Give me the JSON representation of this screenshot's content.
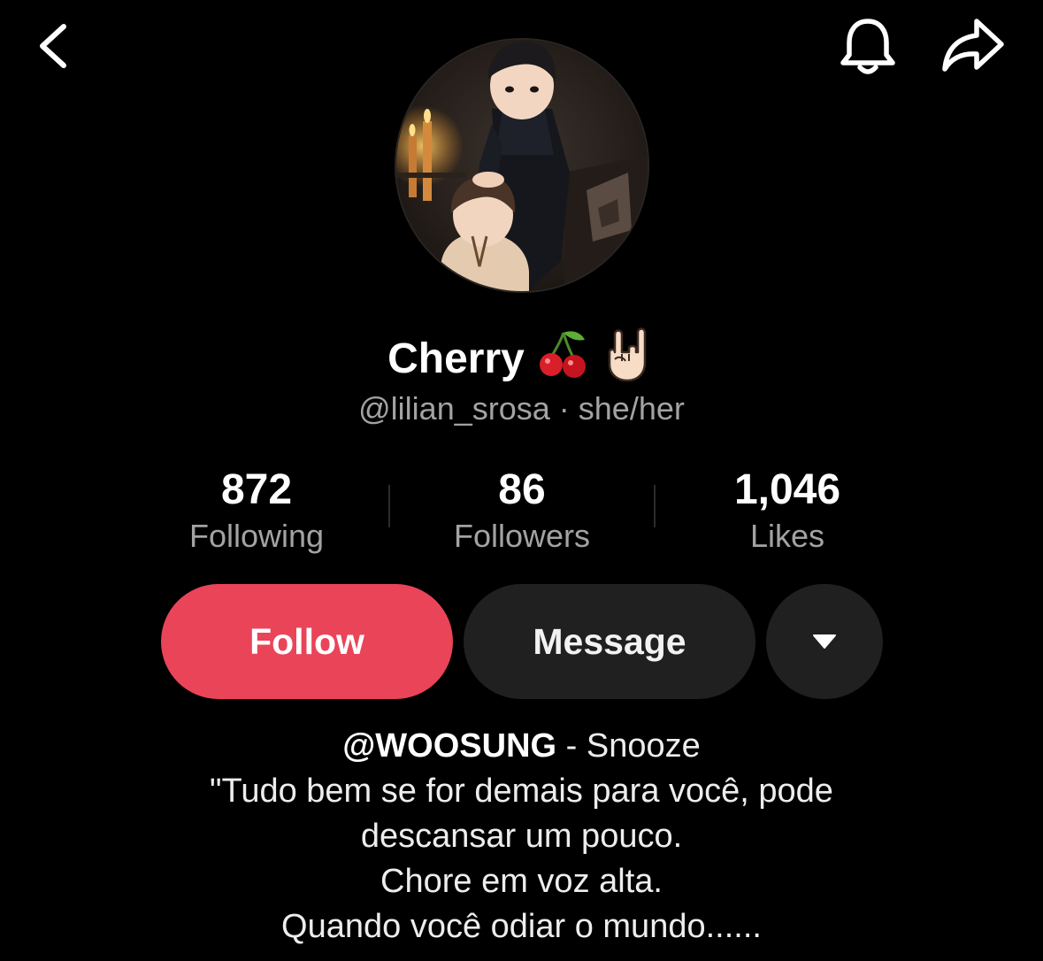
{
  "header": {
    "back_icon": "chevron-left-icon",
    "notification_icon": "bell-icon",
    "share_icon": "share-arrow-icon"
  },
  "profile": {
    "display_name": "Cherry",
    "name_emojis": [
      "🍒",
      "🤘🏻"
    ],
    "username": "@lilian_srosa",
    "separator": "·",
    "pronouns": "she/her"
  },
  "stats": [
    {
      "value": "872",
      "label": "Following"
    },
    {
      "value": "86",
      "label": "Followers"
    },
    {
      "value": "1,046",
      "label": "Likes"
    }
  ],
  "actions": {
    "follow_label": "Follow",
    "message_label": "Message",
    "more_icon": "caret-down-icon"
  },
  "bio": {
    "mention": "@WOOSUNG",
    "mention_suffix": " - Snooze",
    "lines": [
      "\"Tudo bem se for demais para você, pode",
      "descansar um pouco.",
      "Chore em voz alta.",
      "Quando você odiar o mundo......"
    ]
  },
  "colors": {
    "background": "#000000",
    "follow_button": "#ea4459",
    "secondary_button": "#202020",
    "muted_text": "#a3a3a3"
  }
}
